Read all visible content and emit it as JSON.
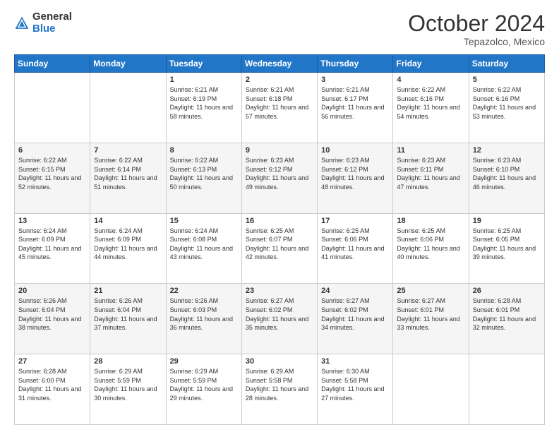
{
  "header": {
    "logo_line1": "General",
    "logo_line2": "Blue",
    "month": "October 2024",
    "location": "Tepazolco, Mexico"
  },
  "weekdays": [
    "Sunday",
    "Monday",
    "Tuesday",
    "Wednesday",
    "Thursday",
    "Friday",
    "Saturday"
  ],
  "weeks": [
    [
      {
        "day": "",
        "sunrise": "",
        "sunset": "",
        "daylight": ""
      },
      {
        "day": "",
        "sunrise": "",
        "sunset": "",
        "daylight": ""
      },
      {
        "day": "1",
        "sunrise": "Sunrise: 6:21 AM",
        "sunset": "Sunset: 6:19 PM",
        "daylight": "Daylight: 11 hours and 58 minutes."
      },
      {
        "day": "2",
        "sunrise": "Sunrise: 6:21 AM",
        "sunset": "Sunset: 6:18 PM",
        "daylight": "Daylight: 11 hours and 57 minutes."
      },
      {
        "day": "3",
        "sunrise": "Sunrise: 6:21 AM",
        "sunset": "Sunset: 6:17 PM",
        "daylight": "Daylight: 11 hours and 56 minutes."
      },
      {
        "day": "4",
        "sunrise": "Sunrise: 6:22 AM",
        "sunset": "Sunset: 6:16 PM",
        "daylight": "Daylight: 11 hours and 54 minutes."
      },
      {
        "day": "5",
        "sunrise": "Sunrise: 6:22 AM",
        "sunset": "Sunset: 6:16 PM",
        "daylight": "Daylight: 11 hours and 53 minutes."
      }
    ],
    [
      {
        "day": "6",
        "sunrise": "Sunrise: 6:22 AM",
        "sunset": "Sunset: 6:15 PM",
        "daylight": "Daylight: 11 hours and 52 minutes."
      },
      {
        "day": "7",
        "sunrise": "Sunrise: 6:22 AM",
        "sunset": "Sunset: 6:14 PM",
        "daylight": "Daylight: 11 hours and 51 minutes."
      },
      {
        "day": "8",
        "sunrise": "Sunrise: 6:22 AM",
        "sunset": "Sunset: 6:13 PM",
        "daylight": "Daylight: 11 hours and 50 minutes."
      },
      {
        "day": "9",
        "sunrise": "Sunrise: 6:23 AM",
        "sunset": "Sunset: 6:12 PM",
        "daylight": "Daylight: 11 hours and 49 minutes."
      },
      {
        "day": "10",
        "sunrise": "Sunrise: 6:23 AM",
        "sunset": "Sunset: 6:12 PM",
        "daylight": "Daylight: 11 hours and 48 minutes."
      },
      {
        "day": "11",
        "sunrise": "Sunrise: 6:23 AM",
        "sunset": "Sunset: 6:11 PM",
        "daylight": "Daylight: 11 hours and 47 minutes."
      },
      {
        "day": "12",
        "sunrise": "Sunrise: 6:23 AM",
        "sunset": "Sunset: 6:10 PM",
        "daylight": "Daylight: 11 hours and 46 minutes."
      }
    ],
    [
      {
        "day": "13",
        "sunrise": "Sunrise: 6:24 AM",
        "sunset": "Sunset: 6:09 PM",
        "daylight": "Daylight: 11 hours and 45 minutes."
      },
      {
        "day": "14",
        "sunrise": "Sunrise: 6:24 AM",
        "sunset": "Sunset: 6:09 PM",
        "daylight": "Daylight: 11 hours and 44 minutes."
      },
      {
        "day": "15",
        "sunrise": "Sunrise: 6:24 AM",
        "sunset": "Sunset: 6:08 PM",
        "daylight": "Daylight: 11 hours and 43 minutes."
      },
      {
        "day": "16",
        "sunrise": "Sunrise: 6:25 AM",
        "sunset": "Sunset: 6:07 PM",
        "daylight": "Daylight: 11 hours and 42 minutes."
      },
      {
        "day": "17",
        "sunrise": "Sunrise: 6:25 AM",
        "sunset": "Sunset: 6:06 PM",
        "daylight": "Daylight: 11 hours and 41 minutes."
      },
      {
        "day": "18",
        "sunrise": "Sunrise: 6:25 AM",
        "sunset": "Sunset: 6:06 PM",
        "daylight": "Daylight: 11 hours and 40 minutes."
      },
      {
        "day": "19",
        "sunrise": "Sunrise: 6:25 AM",
        "sunset": "Sunset: 6:05 PM",
        "daylight": "Daylight: 11 hours and 39 minutes."
      }
    ],
    [
      {
        "day": "20",
        "sunrise": "Sunrise: 6:26 AM",
        "sunset": "Sunset: 6:04 PM",
        "daylight": "Daylight: 11 hours and 38 minutes."
      },
      {
        "day": "21",
        "sunrise": "Sunrise: 6:26 AM",
        "sunset": "Sunset: 6:04 PM",
        "daylight": "Daylight: 11 hours and 37 minutes."
      },
      {
        "day": "22",
        "sunrise": "Sunrise: 6:26 AM",
        "sunset": "Sunset: 6:03 PM",
        "daylight": "Daylight: 11 hours and 36 minutes."
      },
      {
        "day": "23",
        "sunrise": "Sunrise: 6:27 AM",
        "sunset": "Sunset: 6:02 PM",
        "daylight": "Daylight: 11 hours and 35 minutes."
      },
      {
        "day": "24",
        "sunrise": "Sunrise: 6:27 AM",
        "sunset": "Sunset: 6:02 PM",
        "daylight": "Daylight: 11 hours and 34 minutes."
      },
      {
        "day": "25",
        "sunrise": "Sunrise: 6:27 AM",
        "sunset": "Sunset: 6:01 PM",
        "daylight": "Daylight: 11 hours and 33 minutes."
      },
      {
        "day": "26",
        "sunrise": "Sunrise: 6:28 AM",
        "sunset": "Sunset: 6:01 PM",
        "daylight": "Daylight: 11 hours and 32 minutes."
      }
    ],
    [
      {
        "day": "27",
        "sunrise": "Sunrise: 6:28 AM",
        "sunset": "Sunset: 6:00 PM",
        "daylight": "Daylight: 11 hours and 31 minutes."
      },
      {
        "day": "28",
        "sunrise": "Sunrise: 6:29 AM",
        "sunset": "Sunset: 5:59 PM",
        "daylight": "Daylight: 11 hours and 30 minutes."
      },
      {
        "day": "29",
        "sunrise": "Sunrise: 6:29 AM",
        "sunset": "Sunset: 5:59 PM",
        "daylight": "Daylight: 11 hours and 29 minutes."
      },
      {
        "day": "30",
        "sunrise": "Sunrise: 6:29 AM",
        "sunset": "Sunset: 5:58 PM",
        "daylight": "Daylight: 11 hours and 28 minutes."
      },
      {
        "day": "31",
        "sunrise": "Sunrise: 6:30 AM",
        "sunset": "Sunset: 5:58 PM",
        "daylight": "Daylight: 11 hours and 27 minutes."
      },
      {
        "day": "",
        "sunrise": "",
        "sunset": "",
        "daylight": ""
      },
      {
        "day": "",
        "sunrise": "",
        "sunset": "",
        "daylight": ""
      }
    ]
  ]
}
